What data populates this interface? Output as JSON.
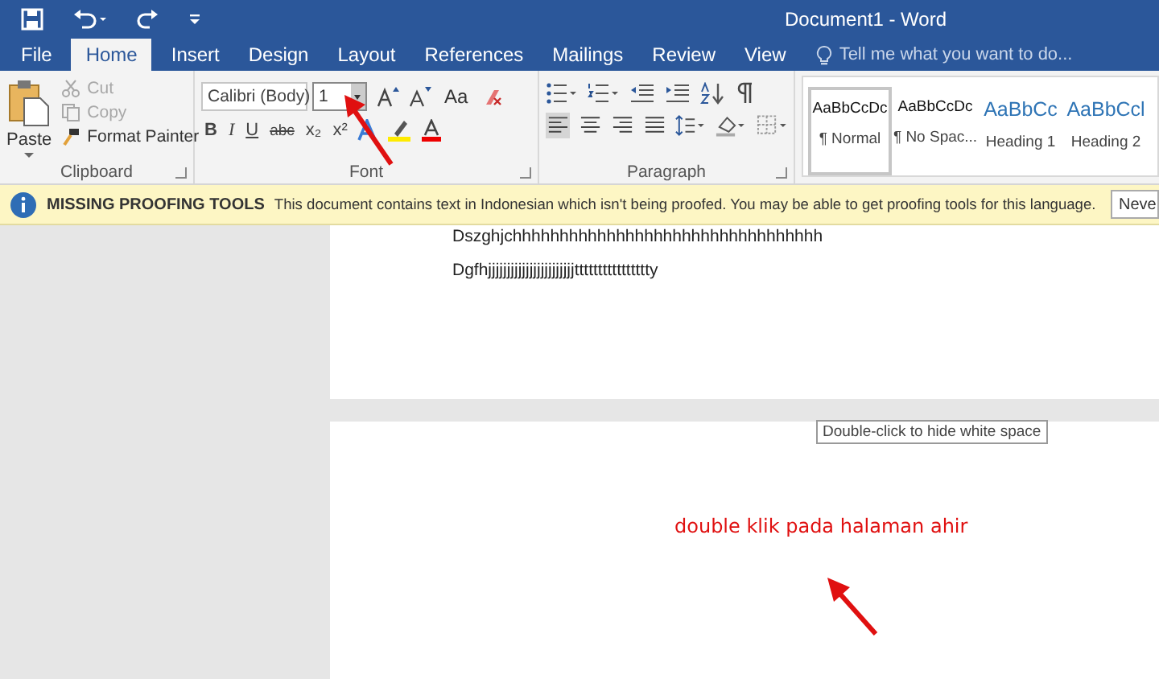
{
  "window": {
    "title": "Document1 - Word"
  },
  "tabs": [
    {
      "label": "File",
      "selected": false
    },
    {
      "label": "Home",
      "selected": true
    },
    {
      "label": "Insert",
      "selected": false
    },
    {
      "label": "Design",
      "selected": false
    },
    {
      "label": "Layout",
      "selected": false
    },
    {
      "label": "References",
      "selected": false
    },
    {
      "label": "Mailings",
      "selected": false
    },
    {
      "label": "Review",
      "selected": false
    },
    {
      "label": "View",
      "selected": false
    }
  ],
  "tell_me": {
    "placeholder": "Tell me what you want to do..."
  },
  "clipboard": {
    "label": "Clipboard",
    "paste": "Paste",
    "items": [
      {
        "label": "Cut",
        "kind": "cut",
        "disabled": true
      },
      {
        "label": "Copy",
        "kind": "copy",
        "disabled": true
      },
      {
        "label": "Format Painter",
        "kind": "painter",
        "disabled": false
      }
    ]
  },
  "font": {
    "label": "Font",
    "family": "Calibri (Body)",
    "size": "1",
    "case_button": "Aa",
    "format_buttons": [
      "B",
      "I",
      "U",
      "abc",
      "x₂",
      "x²"
    ]
  },
  "paragraph": {
    "label": "Paragraph"
  },
  "styles": [
    {
      "preview": "AaBbCcDc",
      "name": "¶ Normal",
      "kind": "body",
      "selected": true
    },
    {
      "preview": "AaBbCcDc",
      "name": "¶ No Spac...",
      "kind": "body",
      "selected": false
    },
    {
      "preview": "AaBbCc",
      "name": "Heading 1",
      "kind": "heading",
      "selected": false
    },
    {
      "preview": "AaBbCcl",
      "name": "Heading 2",
      "kind": "heading",
      "selected": false
    }
  ],
  "message_bar": {
    "title": "MISSING PROOFING TOOLS",
    "text": "This document contains text in Indonesian which isn't being proofed. You may be able to get proofing tools for this language.",
    "button": "Neve"
  },
  "document": {
    "lines": [
      "Dszghjchhhhhhhhhhhhhhhhhhhhhhhhhhhhhhhhh",
      "Dgfhjjjjjjjjjjjjjjjjjjjjjjjtttttttttttttttty"
    ],
    "tooltip": "Double-click to hide white space"
  },
  "annotation": {
    "text": "double klik pada halaman ahir"
  }
}
